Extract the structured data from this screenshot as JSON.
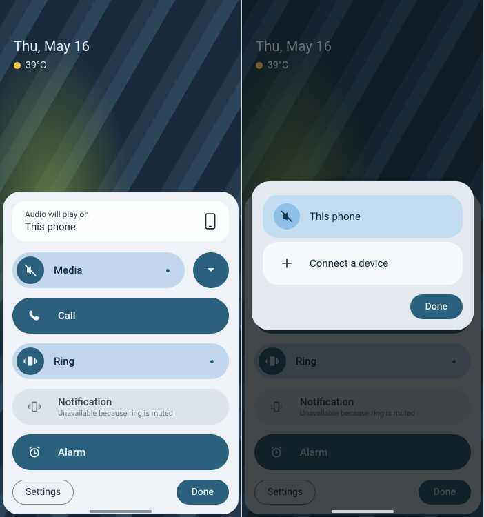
{
  "status": {
    "date": "Thu, May 16",
    "temp": "39°C"
  },
  "output": {
    "label": "Audio will play on",
    "value": "This phone"
  },
  "sliders": {
    "media": {
      "label": "Media"
    },
    "call": {
      "label": "Call"
    },
    "ring": {
      "label": "Ring"
    },
    "notification": {
      "label": "Notification",
      "sub": "Unavailable because ring is muted"
    },
    "alarm": {
      "label": "Alarm"
    }
  },
  "footer": {
    "settings": "Settings",
    "done": "Done"
  },
  "modal": {
    "option_this_phone": "This phone",
    "option_connect": "Connect a device",
    "done": "Done"
  }
}
